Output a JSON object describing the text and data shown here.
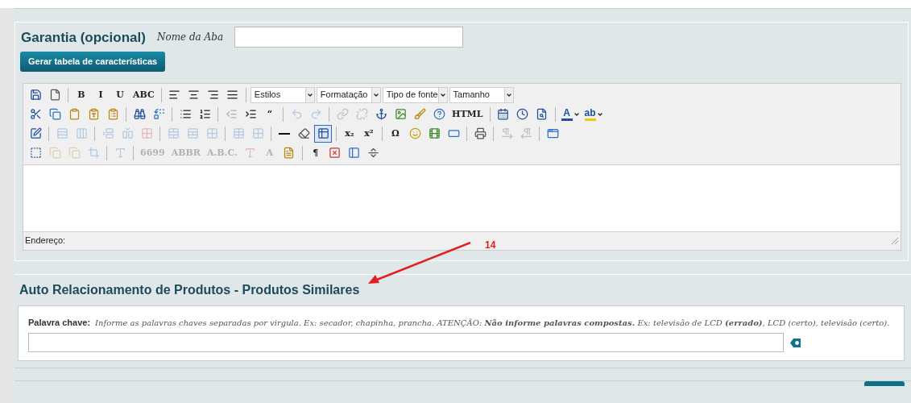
{
  "garantia": {
    "title": "Garantia (opcional)",
    "tab_name_label": "Nome da Aba",
    "generate_button": "Gerar tabela de características"
  },
  "editor": {
    "toolbar_rows": [
      [
        {
          "kind": "button",
          "disabled": false,
          "active": false
        },
        {
          "kind": "button",
          "disabled": false,
          "active": false
        },
        {
          "kind": "separator"
        },
        {
          "kind": "button",
          "label": "B",
          "disabled": false,
          "active": false
        },
        {
          "kind": "button",
          "label": "I",
          "disabled": false,
          "active": false
        },
        {
          "kind": "button",
          "label": "U",
          "disabled": false,
          "active": false
        },
        {
          "kind": "button",
          "label": "ABC",
          "disabled": false,
          "active": false
        },
        {
          "kind": "separator"
        },
        {
          "kind": "button",
          "disabled": false,
          "active": false
        },
        {
          "kind": "button",
          "disabled": false,
          "active": false
        },
        {
          "kind": "button",
          "disabled": false,
          "active": false
        },
        {
          "kind": "button",
          "disabled": false,
          "active": false
        },
        {
          "kind": "separator"
        },
        {
          "kind": "dropdown",
          "label": "Estilos"
        },
        {
          "kind": "dropdown",
          "label": "Formatação"
        },
        {
          "kind": "dropdown",
          "label": "Tipo de fonte"
        },
        {
          "kind": "dropdown",
          "label": "Tamanho"
        }
      ],
      [
        {
          "kind": "button",
          "disabled": false,
          "active": false
        },
        {
          "kind": "button",
          "disabled": false,
          "active": false
        },
        {
          "kind": "button",
          "disabled": false,
          "active": false
        },
        {
          "kind": "button",
          "disabled": false,
          "active": false
        },
        {
          "kind": "button",
          "disabled": false,
          "active": false
        },
        {
          "kind": "separator"
        },
        {
          "kind": "button",
          "disabled": false,
          "active": false
        },
        {
          "kind": "button",
          "disabled": false,
          "active": false
        },
        {
          "kind": "separator"
        },
        {
          "kind": "button",
          "disabled": false,
          "active": false
        },
        {
          "kind": "button",
          "disabled": false,
          "active": false
        },
        {
          "kind": "separator"
        },
        {
          "kind": "button",
          "disabled": true,
          "active": false
        },
        {
          "kind": "button",
          "disabled": false,
          "active": false
        },
        {
          "kind": "button",
          "label": "“",
          "disabled": false,
          "active": false
        },
        {
          "kind": "separator"
        },
        {
          "kind": "button",
          "disabled": true,
          "active": false
        },
        {
          "kind": "button",
          "disabled": true,
          "active": false
        },
        {
          "kind": "separator"
        },
        {
          "kind": "button",
          "disabled": true,
          "active": false
        },
        {
          "kind": "button",
          "disabled": true,
          "active": false
        },
        {
          "kind": "button",
          "disabled": false,
          "active": false
        },
        {
          "kind": "button",
          "disabled": false,
          "active": false
        },
        {
          "kind": "button",
          "disabled": false,
          "active": false
        },
        {
          "kind": "button",
          "disabled": false,
          "active": false
        },
        {
          "kind": "button",
          "label": "HTML",
          "disabled": false,
          "active": false
        },
        {
          "kind": "separator"
        },
        {
          "kind": "button",
          "disabled": false,
          "active": false
        },
        {
          "kind": "button",
          "disabled": false,
          "active": false
        },
        {
          "kind": "button",
          "disabled": false,
          "active": false
        },
        {
          "kind": "separator"
        },
        {
          "kind": "color",
          "label": "A",
          "color": "#1f4e9c"
        },
        {
          "kind": "color",
          "label": "ab",
          "color": "#e8d000"
        }
      ],
      [
        {
          "kind": "button",
          "disabled": false,
          "active": false
        },
        {
          "kind": "separator"
        },
        {
          "kind": "button",
          "disabled": true,
          "active": false
        },
        {
          "kind": "button",
          "disabled": true,
          "active": false
        },
        {
          "kind": "separator"
        },
        {
          "kind": "button",
          "disabled": true,
          "active": false
        },
        {
          "kind": "button",
          "disabled": true,
          "active": false
        },
        {
          "kind": "button",
          "disabled": true,
          "active": false
        },
        {
          "kind": "separator"
        },
        {
          "kind": "button",
          "disabled": true,
          "active": false
        },
        {
          "kind": "button",
          "disabled": true,
          "active": false
        },
        {
          "kind": "button",
          "disabled": true,
          "active": false
        },
        {
          "kind": "separator"
        },
        {
          "kind": "button",
          "disabled": true,
          "active": false
        },
        {
          "kind": "button",
          "disabled": true,
          "active": false
        },
        {
          "kind": "separator"
        },
        {
          "kind": "button",
          "disabled": false,
          "active": false
        },
        {
          "kind": "button",
          "disabled": false,
          "active": false
        },
        {
          "kind": "button",
          "disabled": false,
          "active": true
        },
        {
          "kind": "separator"
        },
        {
          "kind": "button",
          "label": "x₂",
          "disabled": false,
          "active": false
        },
        {
          "kind": "button",
          "label": "x²",
          "disabled": false,
          "active": false
        },
        {
          "kind": "separator"
        },
        {
          "kind": "button",
          "label": "Ω",
          "disabled": false,
          "active": false
        },
        {
          "kind": "button",
          "disabled": false,
          "active": false
        },
        {
          "kind": "button",
          "disabled": false,
          "active": false
        },
        {
          "kind": "button",
          "disabled": false,
          "active": false
        },
        {
          "kind": "separator"
        },
        {
          "kind": "button",
          "disabled": false,
          "active": false
        },
        {
          "kind": "separator"
        },
        {
          "kind": "button",
          "disabled": true,
          "active": false
        },
        {
          "kind": "button",
          "disabled": true,
          "active": false
        },
        {
          "kind": "separator"
        },
        {
          "kind": "button",
          "disabled": false,
          "active": false
        }
      ],
      [
        {
          "kind": "button",
          "disabled": false,
          "active": false
        },
        {
          "kind": "button",
          "disabled": true,
          "active": false
        },
        {
          "kind": "button",
          "disabled": true,
          "active": false
        },
        {
          "kind": "button",
          "disabled": true,
          "active": false
        },
        {
          "kind": "separator"
        },
        {
          "kind": "button",
          "disabled": true,
          "active": false
        },
        {
          "kind": "separator"
        },
        {
          "kind": "button",
          "label": "6699",
          "disabled": true,
          "active": false
        },
        {
          "kind": "button",
          "label": "ABBR",
          "disabled": true,
          "active": false
        },
        {
          "kind": "button",
          "label": "A.B.C.",
          "disabled": true,
          "active": false
        },
        {
          "kind": "button",
          "disabled": true,
          "active": false
        },
        {
          "kind": "button",
          "label": "A",
          "disabled": true,
          "active": false
        },
        {
          "kind": "button",
          "disabled": false,
          "active": false
        },
        {
          "kind": "separator"
        },
        {
          "kind": "button",
          "label": "¶",
          "disabled": false,
          "active": false
        },
        {
          "kind": "button",
          "disabled": false,
          "active": false
        },
        {
          "kind": "button",
          "disabled": false,
          "active": false
        },
        {
          "kind": "button",
          "disabled": false,
          "active": false
        }
      ]
    ],
    "status_label": "Endereço:"
  },
  "annotation": {
    "label": "14"
  },
  "similar": {
    "title": "Auto Relacionamento de Produtos - Produtos Similares",
    "keyword_label": "Palavra chave:",
    "hint": "Informe as palavras chaves separadas por virgula. Ex: secador, chapinha, prancha. ATENÇÃO: **Não informe palavras compostas.** Ex: televisão de LCD **(errado)**, LCD (certo), televisão (certo)."
  }
}
